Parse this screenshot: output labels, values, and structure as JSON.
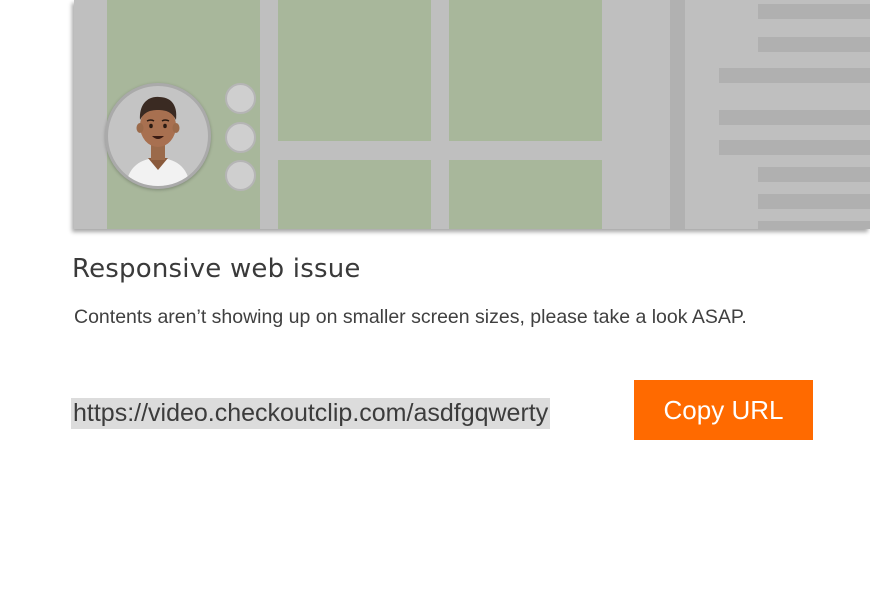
{
  "card": {
    "title": "Responsive web issue",
    "description": "Contents aren’t showing up on smaller screen sizes, please take a look ASAP.",
    "url": "https://video.checkoutclip.com/asdfgqwerty",
    "copy_button_label": "Copy URL"
  },
  "colors": {
    "accent": "#ff6a00",
    "thumbnail_background": "#bfbfbf",
    "tile": "#a8b79b"
  },
  "icons": {
    "avatar": "person-avatar"
  }
}
